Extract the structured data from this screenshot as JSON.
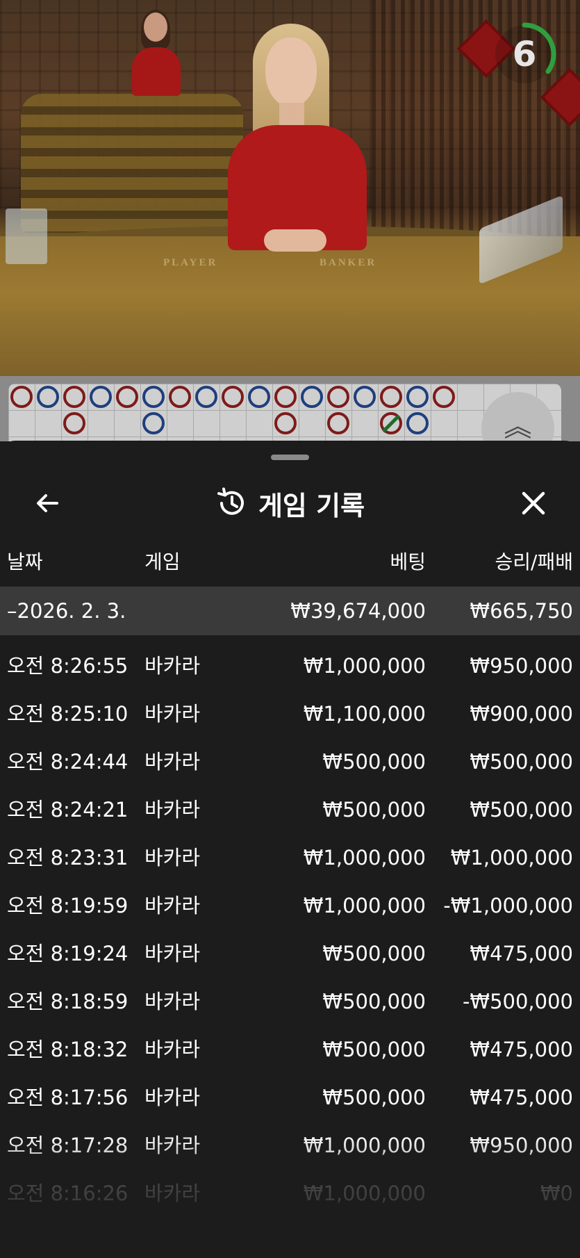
{
  "video": {
    "table_labels": {
      "player": "PLAYER",
      "banker": "BANKER"
    },
    "countdown": "6",
    "countdown_progress": 0.35
  },
  "roadmap": {
    "bead_colors": {
      "banker": "#7d1b1b",
      "player": "#1f3f7c",
      "tie": "#1f6b2a"
    },
    "collapse_icon": "chevron-double-up-icon"
  },
  "sheet": {
    "title": "게임 기록",
    "title_icon": "history-icon",
    "back_icon": "arrow-left-icon",
    "close_icon": "close-icon",
    "columns": {
      "date": "날짜",
      "game": "게임",
      "bet": "베팅",
      "result": "승리/패배"
    },
    "summary": {
      "date": "–2026. 2. 3.",
      "bet": "₩39,674,000",
      "result": "₩665,750"
    },
    "rows": [
      {
        "time": "오전 8:26:55",
        "game": "바카라",
        "bet": "₩1,000,000",
        "result": "₩950,000"
      },
      {
        "time": "오전 8:25:10",
        "game": "바카라",
        "bet": "₩1,100,000",
        "result": "₩900,000"
      },
      {
        "time": "오전 8:24:44",
        "game": "바카라",
        "bet": "₩500,000",
        "result": "₩500,000"
      },
      {
        "time": "오전 8:24:21",
        "game": "바카라",
        "bet": "₩500,000",
        "result": "₩500,000"
      },
      {
        "time": "오전 8:23:31",
        "game": "바카라",
        "bet": "₩1,000,000",
        "result": "₩1,000,000"
      },
      {
        "time": "오전 8:19:59",
        "game": "바카라",
        "bet": "₩1,000,000",
        "result": "-₩1,000,000"
      },
      {
        "time": "오전 8:19:24",
        "game": "바카라",
        "bet": "₩500,000",
        "result": "₩475,000"
      },
      {
        "time": "오전 8:18:59",
        "game": "바카라",
        "bet": "₩500,000",
        "result": "-₩500,000"
      },
      {
        "time": "오전 8:18:32",
        "game": "바카라",
        "bet": "₩500,000",
        "result": "₩475,000"
      },
      {
        "time": "오전 8:17:56",
        "game": "바카라",
        "bet": "₩500,000",
        "result": "₩475,000"
      },
      {
        "time": "오전 8:17:28",
        "game": "바카라",
        "bet": "₩1,000,000",
        "result": "₩950,000"
      },
      {
        "time": "오전 8:16:26",
        "game": "바카라",
        "bet": "₩1,000,000",
        "result": "₩0"
      }
    ]
  }
}
